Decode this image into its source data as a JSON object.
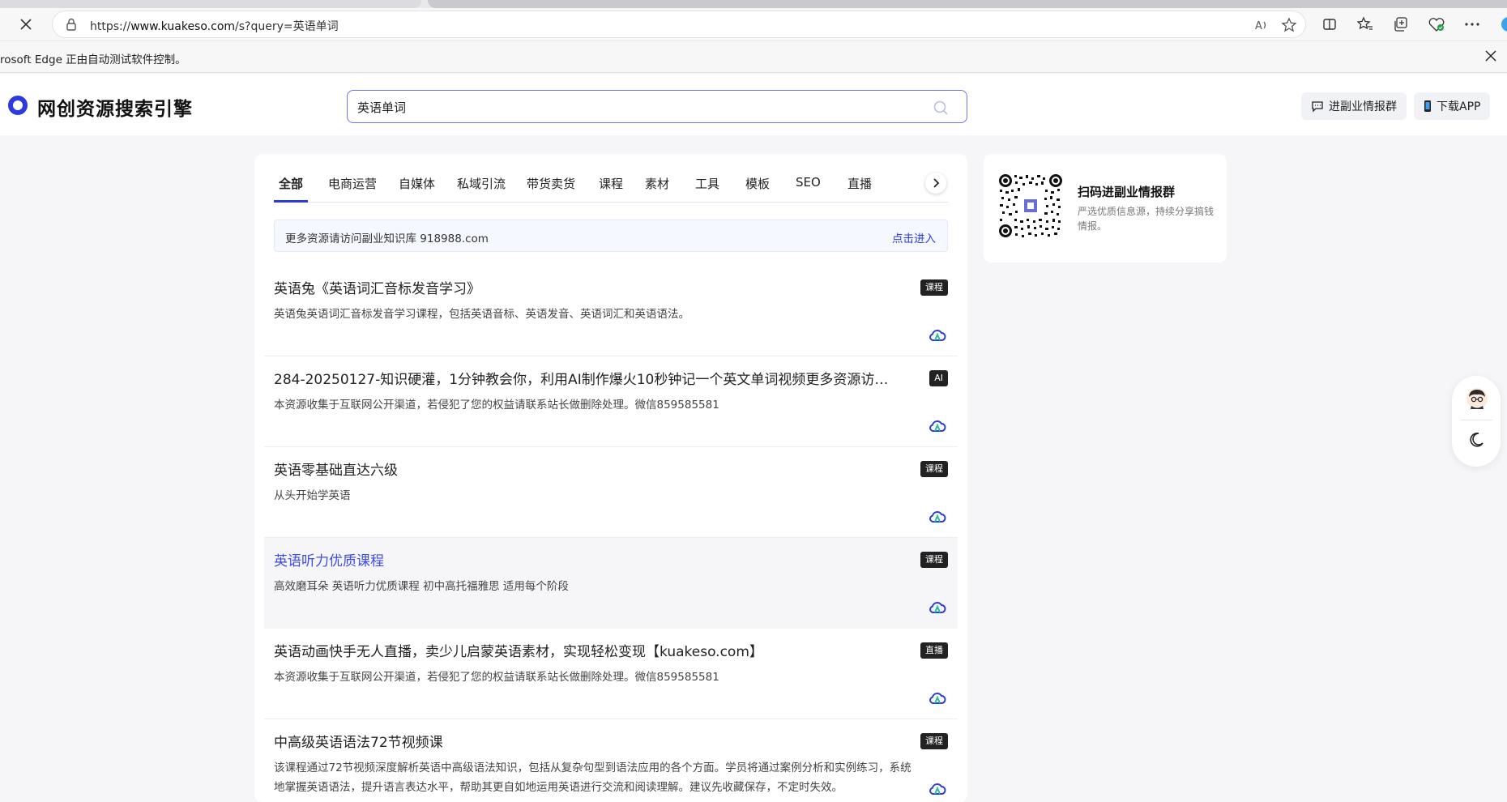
{
  "browser": {
    "url_prefix": "https://",
    "url_host": "www.kuakeso.com",
    "url_path": "/s?query=英语单词",
    "automation_notice": "rosoft Edge 正由自动测试软件控制。"
  },
  "header": {
    "site_title": "网创资源搜索引擎",
    "search_value": "英语单词",
    "btn_group_label": "进副业情报群",
    "btn_app_label": "下载APP"
  },
  "tabs": [
    {
      "label": "全部",
      "active": true
    },
    {
      "label": "电商运营"
    },
    {
      "label": "自媒体"
    },
    {
      "label": "私域引流"
    },
    {
      "label": "带货卖货"
    },
    {
      "label": "课程"
    },
    {
      "label": "素材"
    },
    {
      "label": "工具"
    },
    {
      "label": "模板"
    },
    {
      "label": "SEO"
    },
    {
      "label": "直播"
    }
  ],
  "notice": {
    "text": "更多资源请访问副业知识库 918988.com",
    "link": "点击进入"
  },
  "results": [
    {
      "title": "英语兔《英语词汇音标发音学习》",
      "desc": "英语兔英语词汇音标发音学习课程，包括英语音标、英语发音、英语词汇和英语语法。",
      "badge": "课程"
    },
    {
      "title": "284-20250127-知识硬灌，1分钟教会你，利用AI制作爆火10秒钟记一个英文单词视频更多资源访问...",
      "desc": "本资源收集于互联网公开渠道，若侵犯了您的权益请联系站长做删除处理。微信859585581",
      "badge": "AI"
    },
    {
      "title": "英语零基础直达六级",
      "desc": "从头开始学英语",
      "badge": "课程"
    },
    {
      "title": "英语听力优质课程",
      "desc": "高效磨耳朵 英语听力优质课程 初中高托福雅思 适用每个阶段",
      "badge": "课程"
    },
    {
      "title": "英语动画快手无人直播，卖少儿启蒙英语素材，实现轻松变现【kuakeso.com】",
      "desc": "本资源收集于互联网公开渠道，若侵犯了您的权益请联系站长做删除处理。微信859585581",
      "badge": "直播"
    },
    {
      "title": "中高级英语语法72节视频课",
      "desc": "该课程通过72节视频深度解析英语中高级语法知识，包括从复杂句型到语法应用的各个方面。学员将通过案例分析和实例练习，系统地掌握英语语法，提升语言表达水平，帮助其更自如地运用英语进行交流和阅读理解。建议先收藏保存，不定时失效。",
      "badge": "课程"
    }
  ],
  "side": {
    "title": "扫码进副业情报群",
    "desc": "严选优质信息源，持续分享搞钱情报。"
  },
  "colors": {
    "accent": "#2b3be0",
    "badge_bg": "#222222",
    "cloud": "#2b3be0"
  }
}
